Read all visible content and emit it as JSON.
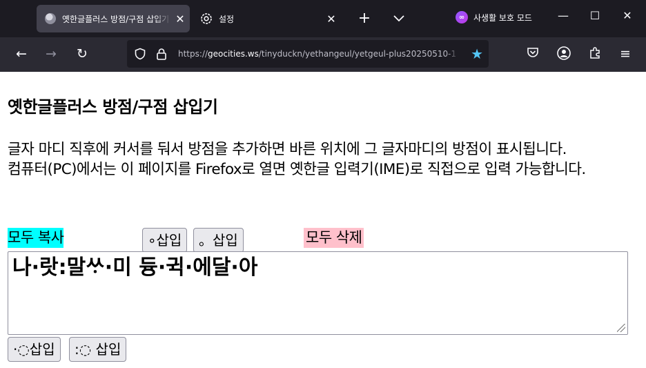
{
  "tabs": {
    "active_title": "옛한글플러스 방점/구점 삽입기",
    "settings_title": "설정"
  },
  "private_mode_label": "사생활 보호 모드",
  "nav": {
    "url_prefix": "https://",
    "url_host": "geocities.ws",
    "url_path": "/tinyduckn/yethangeul/yetgeul-plus20250510-1"
  },
  "page": {
    "title": "옛한글플러스 방점/구점 삽입기",
    "desc_line1": "글자 마디 직후에 커서를 둬서 방점을 추가하면 바른 위치에 그 글자마디의 방점이 표시됩니다.",
    "desc_line2": "컴퓨터(PC)에서는 이 페이지를 Firefox로 열면 옛한글 입력기(IME)로 직접으로 입력 가능합니다.",
    "copy_all": "모두 복사",
    "insert_btn1": "∘삽입",
    "insert_btn2": "。삽입",
    "delete_all": "모두 삭제",
    "editor_text": "나·랏:말ᄊᆞ·미 듕·귁·에달·아",
    "bottom_btn1": "·◌삽입",
    "bottom_btn2": ":◌ 삽입"
  }
}
